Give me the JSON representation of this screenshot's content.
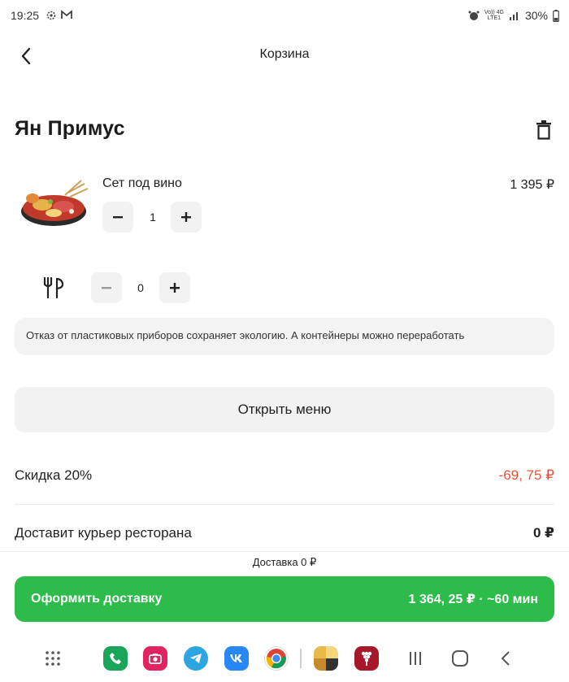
{
  "status_bar": {
    "time": "19:25",
    "battery": "30%",
    "network_top": "Vo)) 4G",
    "network_bottom": "LTE1",
    "icons": [
      "settings-gear-icon",
      "gmail-icon",
      "alarm-icon",
      "signal-icon",
      "battery-icon"
    ]
  },
  "header": {
    "title": "Корзина",
    "back_icon": "chevron-left-icon"
  },
  "restaurant": {
    "name": "Ян Примус",
    "delete_icon": "trash-icon"
  },
  "cart_item": {
    "name": "Сет под вино",
    "price": "1 395 ₽",
    "quantity": "1",
    "minus": "−",
    "plus": "+"
  },
  "cutlery": {
    "quantity": "0",
    "minus": "−",
    "plus": "+",
    "icon": "cutlery-icon"
  },
  "eco_note": "Отказ от пластиковых приборов сохраняет экологию. А контейнеры можно переработать",
  "menu_button": "Открыть меню",
  "summary": {
    "discount_label": "Скидка 20%",
    "discount_value": "-69, 75 ₽",
    "delivery_label": "Доставит курьер ресторана",
    "delivery_value": "0 ₽"
  },
  "delivery_note": "Доставка 0 ₽",
  "checkout": {
    "label": "Оформить доставку",
    "total": "1 364, 25 ₽ · ~60 мин"
  },
  "colors": {
    "accent_green": "#2dbb4a",
    "discount_red": "#e8533b",
    "button_gray": "#f2f2f2"
  },
  "nav_bar": {
    "apps": [
      "app-drawer-icon",
      "phone-icon",
      "camera-icon",
      "telegram-icon",
      "vk-icon",
      "chrome-icon",
      "gallery-icon",
      "app-icon"
    ],
    "recents": "recents-icon",
    "home": "home-icon",
    "back": "back-icon"
  }
}
